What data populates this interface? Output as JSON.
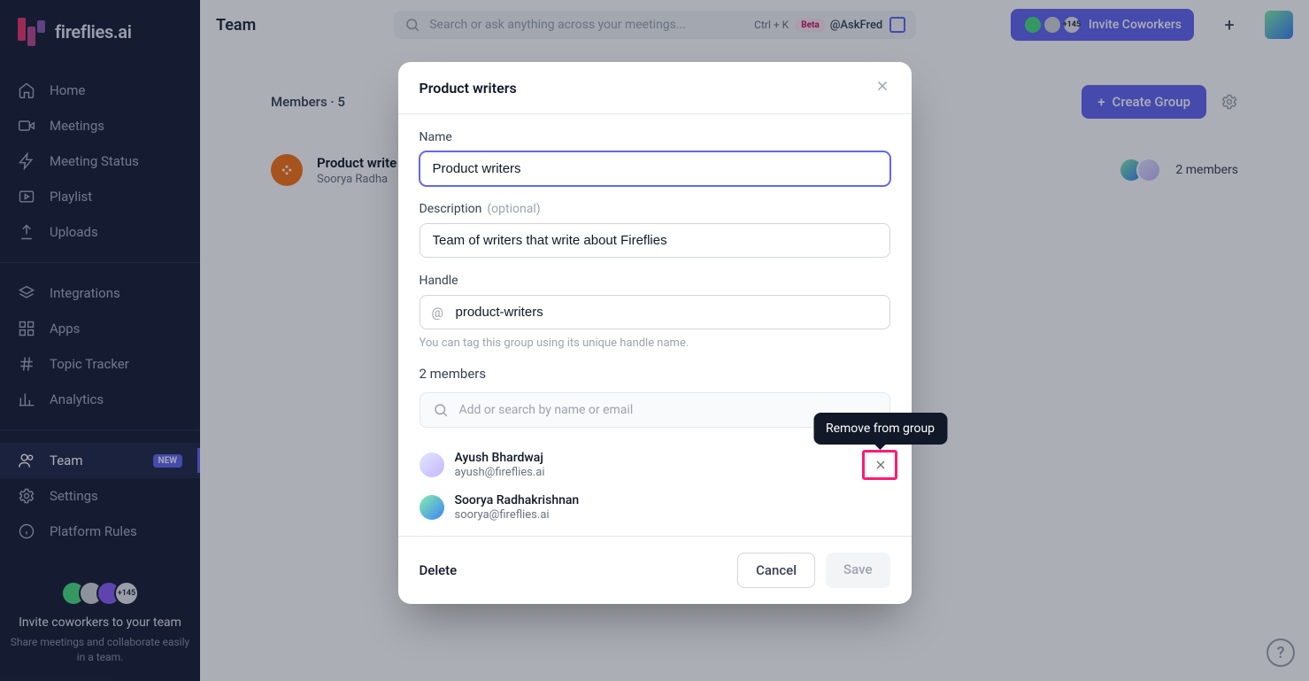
{
  "brand": {
    "name": "fireflies.ai"
  },
  "sidebar": {
    "items": [
      {
        "label": "Home"
      },
      {
        "label": "Meetings"
      },
      {
        "label": "Meeting Status"
      },
      {
        "label": "Playlist"
      },
      {
        "label": "Uploads"
      },
      {
        "label": "Integrations"
      },
      {
        "label": "Apps"
      },
      {
        "label": "Topic Tracker"
      },
      {
        "label": "Analytics"
      },
      {
        "label": "Team",
        "badge": "NEW",
        "active": true
      },
      {
        "label": "Settings"
      },
      {
        "label": "Platform Rules"
      }
    ],
    "footer": {
      "count_badge": "+145",
      "title": "Invite coworkers to your team",
      "sub": "Share meetings and collaborate easily in a team."
    }
  },
  "header": {
    "page_title": "Team",
    "search_placeholder": "Search or ask anything across your meetings...",
    "shortcut": "Ctrl + K",
    "beta_label": "Beta",
    "askfred": "@AskFred",
    "invite_count": "+145",
    "invite_label": "Invite Coworkers"
  },
  "content": {
    "tab_label": "Members · 5",
    "create_group": "Create Group",
    "group": {
      "name": "Product write",
      "members_line": "Soorya Radha",
      "count_label": "2 members"
    }
  },
  "modal": {
    "title": "Product writers",
    "name_label": "Name",
    "name_value": "Product writers",
    "desc_label": "Description",
    "desc_optional": "(optional)",
    "desc_value": "Team of writers that write about Fireflies",
    "handle_label": "Handle",
    "handle_value": "product-writers",
    "handle_hint": "You can tag this group using its unique handle name.",
    "members_count": "2 members",
    "search_placeholder": "Add or search by name or email",
    "members": [
      {
        "name": "Ayush Bhardwaj",
        "email": "ayush@fireflies.ai"
      },
      {
        "name": "Soorya Radhakrishnan",
        "email": "soorya@fireflies.ai"
      }
    ],
    "tooltip": "Remove from group",
    "delete": "Delete",
    "cancel": "Cancel",
    "save": "Save"
  },
  "help": "?"
}
